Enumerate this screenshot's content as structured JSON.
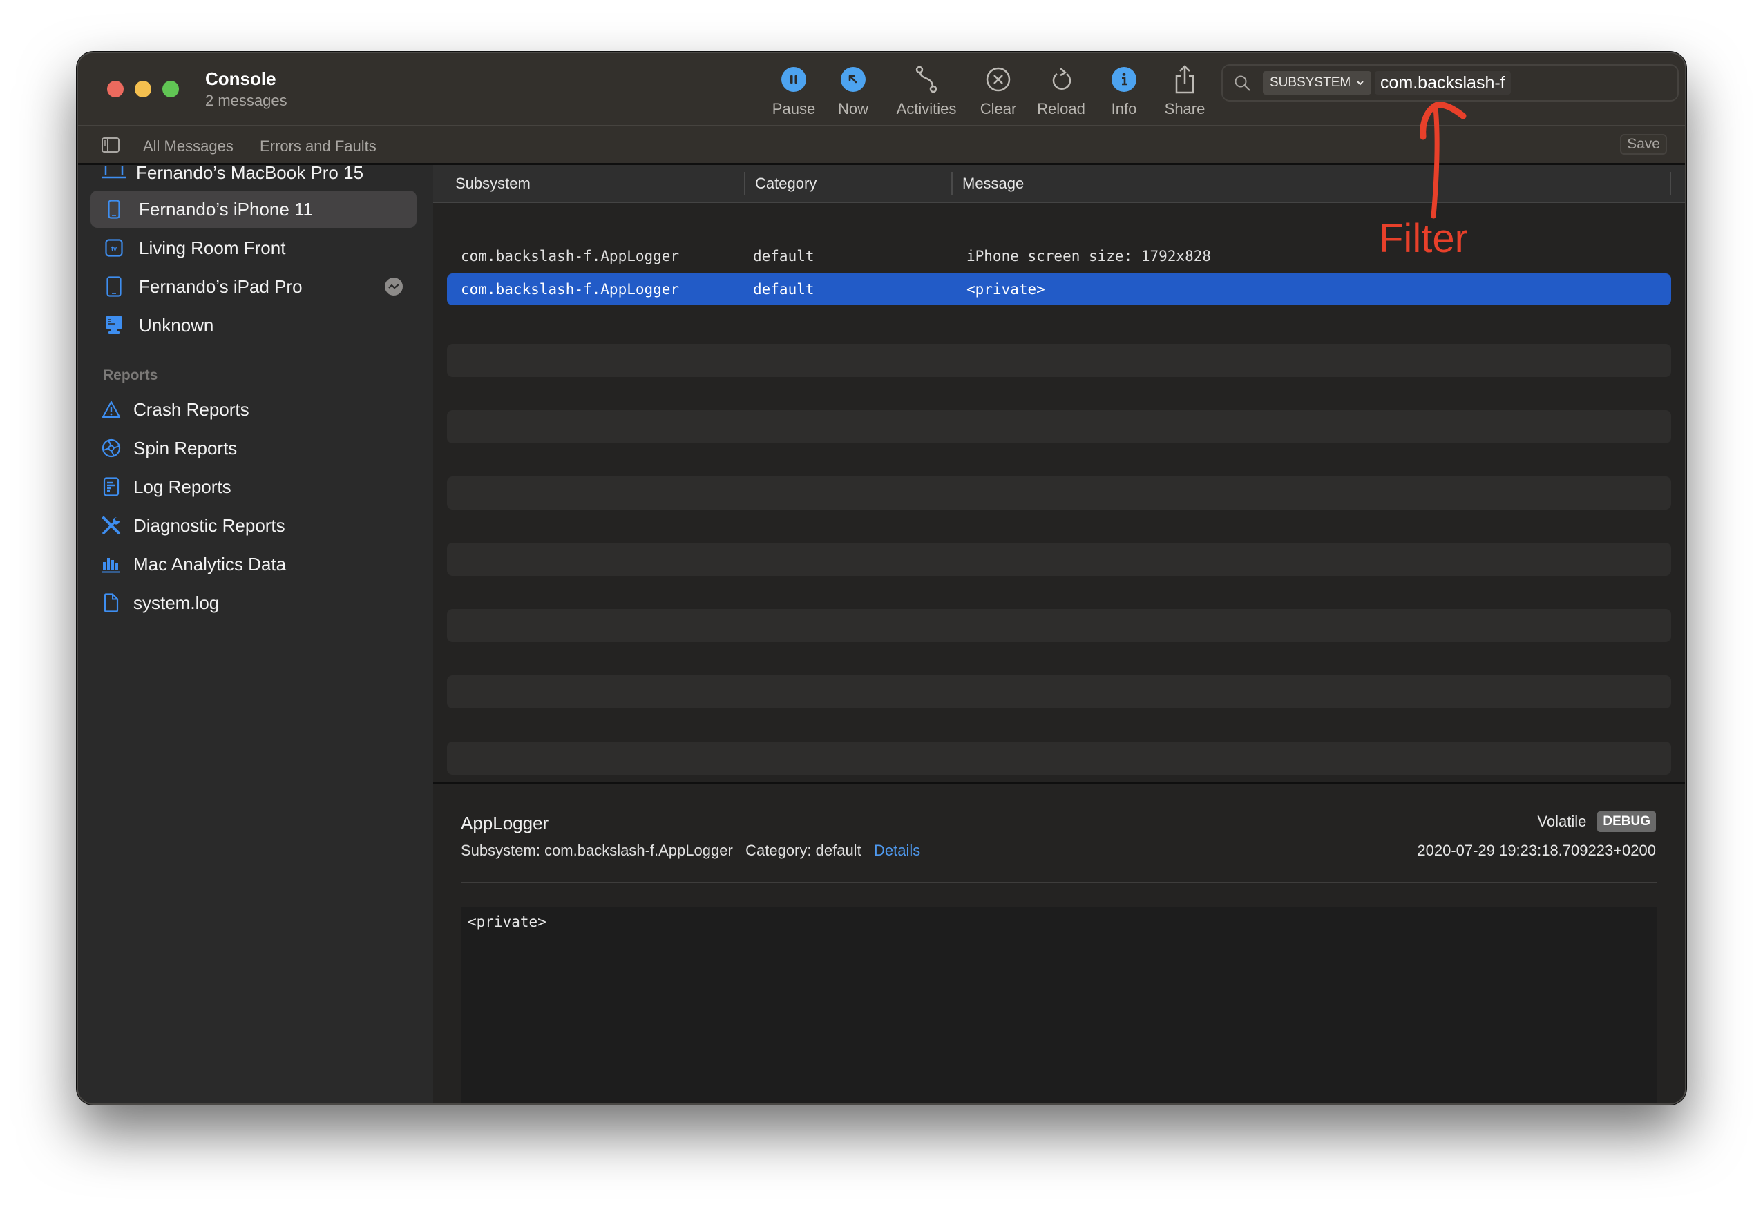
{
  "window": {
    "title": "Console",
    "subtitle": "2 messages"
  },
  "toolbar": {
    "buttons": [
      {
        "label": "Pause",
        "icon": "pause-icon"
      },
      {
        "label": "Now",
        "icon": "now-arrow-icon"
      },
      {
        "label": "Activities",
        "icon": "activities-icon"
      },
      {
        "label": "Clear",
        "icon": "clear-icon"
      },
      {
        "label": "Reload",
        "icon": "reload-icon"
      },
      {
        "label": "Info",
        "icon": "info-icon"
      },
      {
        "label": "Share",
        "icon": "share-icon"
      }
    ],
    "search": {
      "token": "SUBSYSTEM",
      "value": "com.backslash-f"
    }
  },
  "filterbar": {
    "tabs": [
      "All Messages",
      "Errors and Faults"
    ],
    "save_label": "Save"
  },
  "sidebar": {
    "devices": [
      {
        "label": "Fernando’s MacBook Pro 15",
        "icon": "laptop-icon",
        "selected": false
      },
      {
        "label": "Fernando’s iPhone 11",
        "icon": "iphone-icon",
        "selected": true
      },
      {
        "label": "Living Room Front",
        "icon": "apple-tv-icon",
        "selected": false
      },
      {
        "label": "Fernando’s iPad Pro",
        "icon": "ipad-icon",
        "selected": false,
        "badge": "activity-icon"
      },
      {
        "label": "Unknown",
        "icon": "desktop-icon",
        "selected": false
      }
    ],
    "reports_header": "Reports",
    "reports": [
      {
        "label": "Crash Reports",
        "icon": "warning-triangle-icon"
      },
      {
        "label": "Spin Reports",
        "icon": "spin-icon"
      },
      {
        "label": "Log Reports",
        "icon": "log-document-icon"
      },
      {
        "label": "Diagnostic Reports",
        "icon": "tools-icon"
      },
      {
        "label": "Mac Analytics Data",
        "icon": "bar-chart-icon"
      },
      {
        "label": "system.log",
        "icon": "file-icon"
      }
    ]
  },
  "table": {
    "columns": [
      "Subsystem",
      "Category",
      "Message"
    ],
    "rows": [
      {
        "subsystem": "com.backslash-f.AppLogger",
        "category": "default",
        "message": "iPhone screen size: 1792x828",
        "selected": false
      },
      {
        "subsystem": "com.backslash-f.AppLogger",
        "category": "default",
        "message": "<private>",
        "selected": true
      }
    ]
  },
  "detail": {
    "title": "AppLogger",
    "subsystem_label": "Subsystem:",
    "subsystem": "com.backslash-f.AppLogger",
    "category_label": "Category:",
    "category": "default",
    "details_link": "Details",
    "volatile": "Volatile",
    "level_badge": "DEBUG",
    "timestamp": "2020-07-29 19:23:18.709223+0200",
    "body": "<private>"
  },
  "annotation": {
    "text": "Filter",
    "color": "#e8402a"
  },
  "colors": {
    "accent": "#4da3f0",
    "selection": "#225bc7",
    "link": "#4f9af0"
  }
}
